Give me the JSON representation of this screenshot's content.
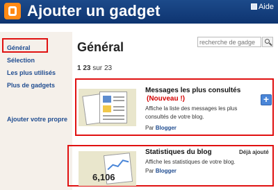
{
  "header": {
    "title": "Ajouter un gadget",
    "help_label": "Aide",
    "logo_icon": "blogger-logo-icon",
    "background": "#1c4a8a"
  },
  "sidebar": {
    "items": [
      {
        "label": "Général",
        "selected": true
      },
      {
        "label": "Sélection"
      },
      {
        "label": "Les plus utilisés"
      },
      {
        "label": "Plus de gadgets"
      },
      {
        "label": "Ajouter votre propre"
      }
    ]
  },
  "main": {
    "title": "Général",
    "search": {
      "placeholder": "recherche de gadge"
    },
    "pagination": {
      "range": "1 23",
      "of_label": "sur",
      "total": "23"
    },
    "gadgets": [
      {
        "title": "Messages les plus consultés",
        "badge": "(Nouveau !)",
        "description": "Affiche la liste des messages les plus consultés de votre blog.",
        "by_label": "Par",
        "author": "Blogger",
        "action": "+"
      },
      {
        "title": "Statistiques du blog",
        "description": "Affiche les statistiques de votre blog.",
        "by_label": "Par",
        "author": "Blogger",
        "status": "Déjà ajouté",
        "thumb_number": "6,106"
      }
    ]
  },
  "colors": {
    "highlight_border": "#e01010",
    "link": "#1f4c90",
    "new_badge": "#d40000"
  }
}
